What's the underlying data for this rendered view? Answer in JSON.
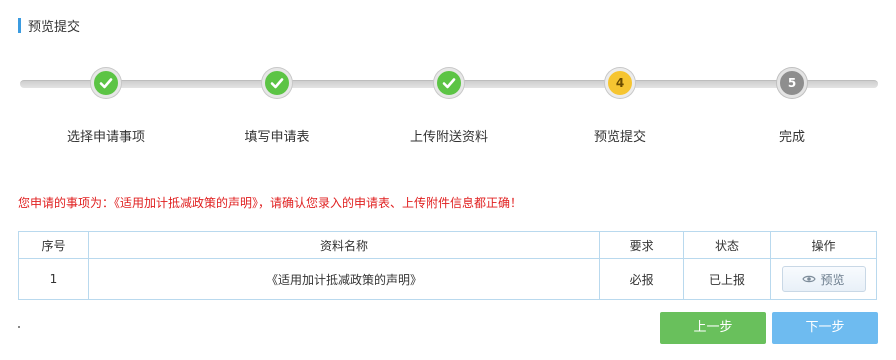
{
  "section_title": "预览提交",
  "steps": [
    {
      "label": "选择申请事项",
      "state": "done",
      "number": ""
    },
    {
      "label": "填写申请表",
      "state": "done",
      "number": ""
    },
    {
      "label": "上传附送资料",
      "state": "done",
      "number": ""
    },
    {
      "label": "预览提交",
      "state": "current",
      "number": "4"
    },
    {
      "label": "完成",
      "state": "todo",
      "number": "5"
    }
  ],
  "notice": "您申请的事项为：《适用加计抵减政策的声明》，请确认您录入的申请表、上传附件信息都正确！",
  "table": {
    "headers": [
      "序号",
      "资料名称",
      "要求",
      "状态",
      "操作"
    ],
    "rows": [
      {
        "index": "1",
        "name": "《适用加计抵减政策的声明》",
        "requirement": "必报",
        "status": "已上报",
        "action": "预览"
      }
    ]
  },
  "buttons": {
    "prev": "上一步",
    "next": "下一步"
  },
  "colors": {
    "done": "#5cc445",
    "current": "#f6c531",
    "todo": "#8e8e8e",
    "notice": "#e02020",
    "prev": "#69c05c",
    "next": "#6ebbf0"
  }
}
